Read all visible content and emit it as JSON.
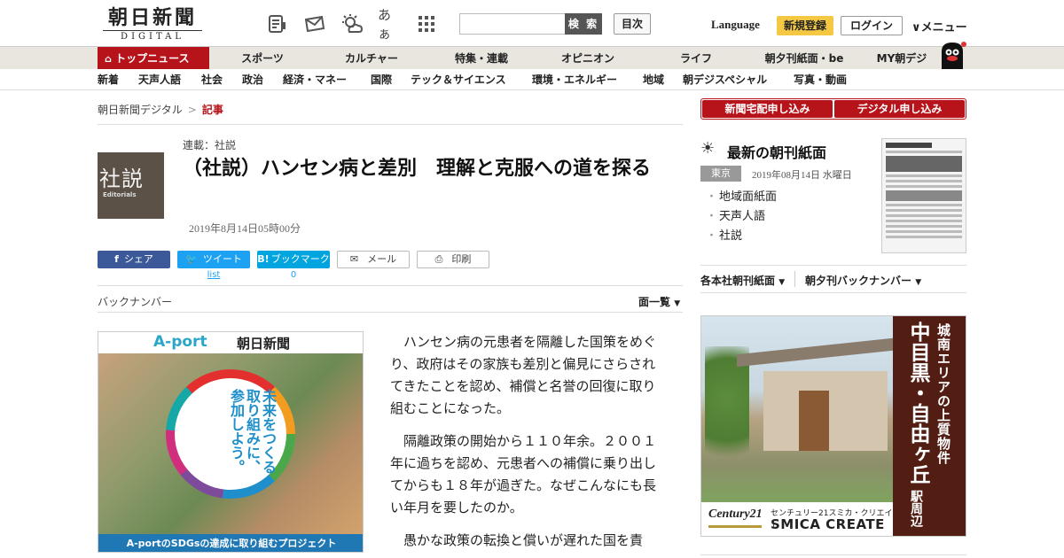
{
  "header": {
    "logo_main": "朝日新聞",
    "logo_sub": "DIGITAL",
    "search_placeholder": "",
    "search_button": "検 索",
    "toc_button": "目次",
    "language": "Language",
    "signup": "新規登録",
    "login": "ログイン",
    "menu": "メニュー",
    "icons": [
      "newspaper-icon",
      "mail-icon",
      "weather-icon",
      "font-size-icon",
      "grid-icon"
    ],
    "font_icon_text": "あぁ"
  },
  "nav_main": {
    "top_news": "トップニュース",
    "items": [
      "スポーツ",
      "カルチャー",
      "特集・連載",
      "オピニオン",
      "ライフ",
      "朝夕刊紙面・be",
      "MY朝デジ"
    ]
  },
  "nav_sub": {
    "items": [
      "新着",
      "天声人語",
      "社会",
      "政治",
      "経済・マネー",
      "国際",
      "テック＆サイエンス",
      "環境・エネルギー",
      "地域",
      "朝デジスペシャル",
      "写真・動画"
    ]
  },
  "breadcrumb": {
    "home": "朝日新聞デジタル",
    "separator": ">",
    "current": "記事"
  },
  "article": {
    "category_big": "社説",
    "category_en": "Editorials",
    "series": "連載：社説",
    "title": "（社説）ハンセン病と差別　理解と克服への道を探る",
    "date": "2019年8月14日05時00分",
    "share": {
      "facebook": "シェア",
      "twitter": "ツイート",
      "twitter_sub": "list",
      "hatena": "ブックマーク",
      "hatena_sub": "0",
      "mail": "メール",
      "print": "印刷"
    },
    "backnumber": "バックナンバー",
    "page_list": "面一覧",
    "paragraphs": [
      "ハンセン病の元患者を隔離した国策をめぐり、政府はその家族も差別と偏見にさらされてきたことを認め、補償と名誉の回復に取り組むことになった。",
      "隔離政策の開始から１１０年余。２００１年に過ちを認め、元患者への補償に乗り出してからも１８年が過ぎた。なぜこんなにも長い年月を要したのか。",
      "愚かな政策の転換と償いが遅れた国を責"
    ]
  },
  "ad_left": {
    "brand": "A-port",
    "paper": "朝日新聞",
    "tagline": "未来をつくる取り組みに、参加しよう。",
    "footer": "A-portのSDGsの達成に取り組むプロジェクト"
  },
  "sidebar": {
    "subscribe_home": "新聞宅配申し込み",
    "subscribe_digital": "デジタル申し込み",
    "morning_paper_title": "最新の朝刊紙面",
    "region": "東京",
    "paper_date": "2019年08月14日 水曜日",
    "links": [
      "地域面紙面",
      "天声人語",
      "社説"
    ],
    "tab_a": "各本社朝刊紙面",
    "tab_b": "朝夕刊バックナンバー"
  },
  "ad_right": {
    "line1": "城南エリアの上質物件",
    "line2": "中目黒・自由ヶ丘",
    "line3": "駅周辺",
    "brand_c21": "Century21",
    "brand_jp": "センチュリー21スミカ・クリエイト",
    "brand_en": "SMICA CREATE"
  },
  "colors": {
    "brand_red": "#b6131b",
    "signup_yellow": "#f5c844",
    "nav_bg": "#e8e6df"
  }
}
